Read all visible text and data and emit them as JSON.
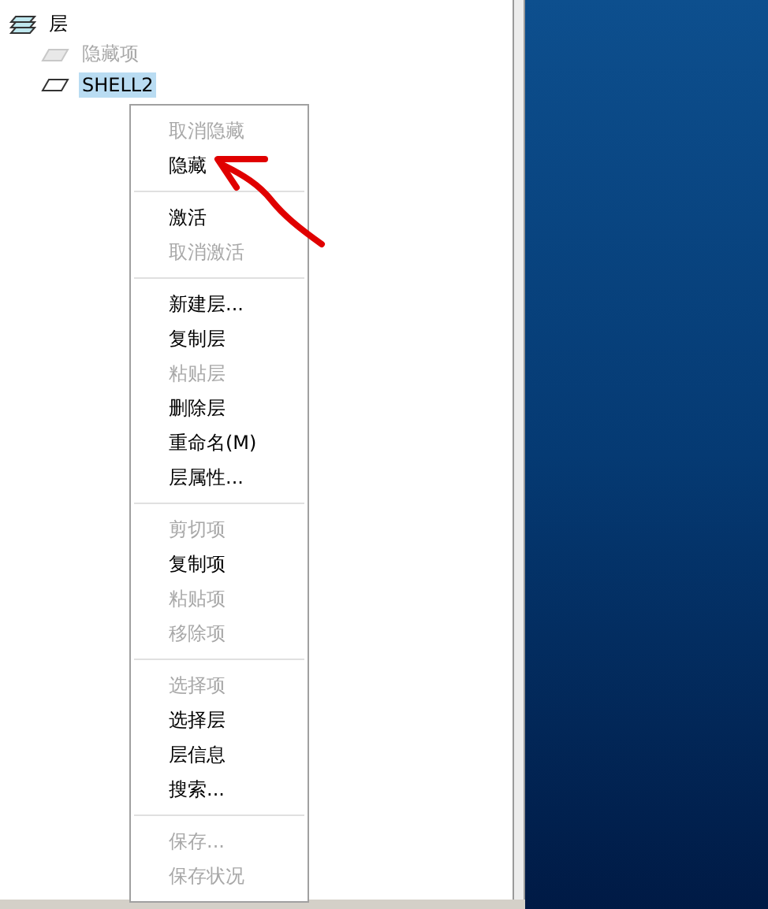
{
  "tree": {
    "label": "层",
    "children": [
      {
        "label": "隐藏项",
        "disabled": true,
        "selected": false
      },
      {
        "label": "SHELL2",
        "disabled": false,
        "selected": true
      }
    ]
  },
  "context_menu": {
    "groups": [
      [
        {
          "label": "取消隐藏",
          "disabled": true
        },
        {
          "label": "隐藏",
          "disabled": false
        }
      ],
      [
        {
          "label": "激活",
          "disabled": false
        },
        {
          "label": "取消激活",
          "disabled": true
        }
      ],
      [
        {
          "label": "新建层...",
          "disabled": false
        },
        {
          "label": "复制层",
          "disabled": false
        },
        {
          "label": "粘贴层",
          "disabled": true
        },
        {
          "label": "删除层",
          "disabled": false
        },
        {
          "label": "重命名(M)",
          "disabled": false
        },
        {
          "label": "层属性...",
          "disabled": false
        }
      ],
      [
        {
          "label": "剪切项",
          "disabled": true
        },
        {
          "label": "复制项",
          "disabled": false
        },
        {
          "label": "粘贴项",
          "disabled": true
        },
        {
          "label": "移除项",
          "disabled": true
        }
      ],
      [
        {
          "label": "选择项",
          "disabled": true
        },
        {
          "label": "选择层",
          "disabled": false
        },
        {
          "label": "层信息",
          "disabled": false
        },
        {
          "label": "搜索...",
          "disabled": false
        }
      ],
      [
        {
          "label": "保存...",
          "disabled": true
        },
        {
          "label": "保存状况",
          "disabled": true
        }
      ]
    ]
  }
}
